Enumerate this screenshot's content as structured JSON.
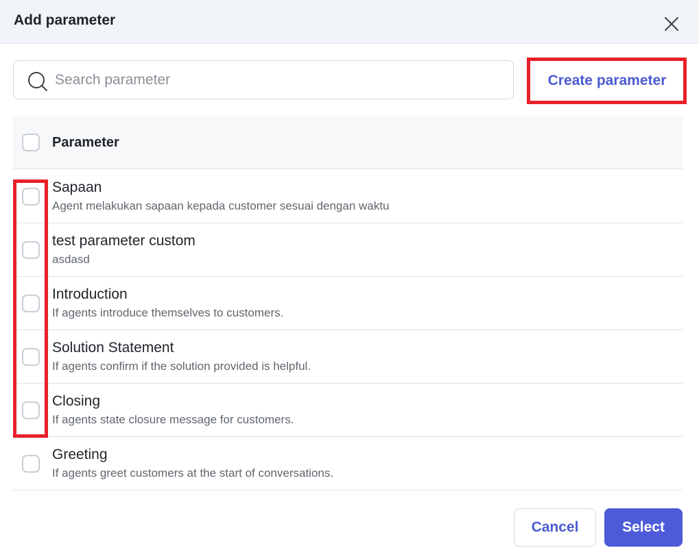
{
  "modal": {
    "title": "Add parameter",
    "close_icon": "close-icon"
  },
  "search": {
    "placeholder": "Search parameter",
    "value": "",
    "icon": "search-icon"
  },
  "toolbar": {
    "create_label": "Create parameter"
  },
  "table": {
    "header_label": "Parameter",
    "rows": [
      {
        "title": "Sapaan",
        "description": "Agent melakukan sapaan kepada customer sesuai dengan waktu",
        "checked": false
      },
      {
        "title": "test parameter custom",
        "description": "asdasd",
        "checked": false
      },
      {
        "title": "Introduction",
        "description": "If agents introduce themselves to customers.",
        "checked": false
      },
      {
        "title": "Solution Statement",
        "description": "If agents confirm if the solution provided is helpful.",
        "checked": false
      },
      {
        "title": "Closing",
        "description": "If agents state closure message for customers.",
        "checked": false
      },
      {
        "title": "Greeting",
        "description": "If agents greet customers at the start of conversations.",
        "checked": false
      }
    ]
  },
  "footer": {
    "cancel_label": "Cancel",
    "select_label": "Select"
  },
  "colors": {
    "accent": "#4d5bd9",
    "highlight": "#e8202a",
    "header_bg": "#f1f4f8"
  }
}
